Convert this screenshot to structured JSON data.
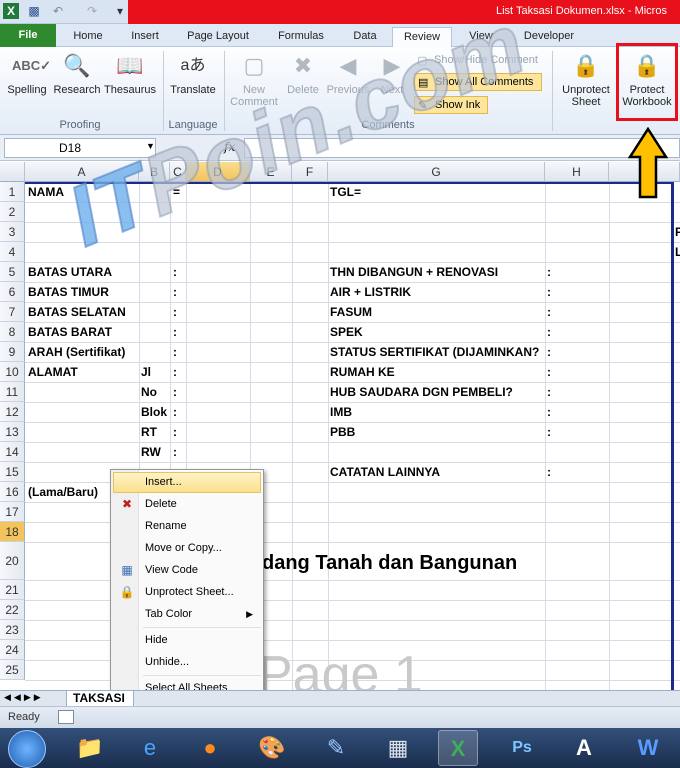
{
  "window": {
    "title": "List Taksasi Dokumen.xlsx - Micros",
    "qat_icons": [
      "excel-logo-icon",
      "save-icon",
      "undo-icon",
      "redo-icon",
      "customize-icon"
    ]
  },
  "tabs": [
    "File",
    "Home",
    "Insert",
    "Page Layout",
    "Formulas",
    "Data",
    "Review",
    "View",
    "Developer"
  ],
  "ribbon": {
    "proofing": {
      "label": "Proofing",
      "spelling": "Spelling",
      "research": "Research",
      "thesaurus": "Thesaurus"
    },
    "language": {
      "label": "Language",
      "translate": "Translate"
    },
    "comments": {
      "label": "Comments",
      "new_comment_1": "New",
      "new_comment_2": "Comment",
      "delete": "Delete",
      "previous": "Previous",
      "next": "Next",
      "show_hide": "Show/Hide Comment",
      "show_all": "Show All Comments",
      "show_ink": "Show Ink"
    },
    "changes": {
      "unprotect_1": "Unprotect",
      "unprotect_2": "Sheet",
      "protect_1": "Protect",
      "protect_2": "Workbook"
    }
  },
  "formula_bar": {
    "name_box": "D18",
    "fx": "fx",
    "formula": ""
  },
  "columns": [
    "A",
    "B",
    "C",
    "D",
    "E",
    "F",
    "G",
    "H"
  ],
  "rows": [
    "1",
    "2",
    "3",
    "4",
    "5",
    "6",
    "7",
    "8",
    "9",
    "10",
    "11",
    "12",
    "13",
    "14",
    "15",
    "16",
    "17",
    "18",
    "20",
    "21",
    "22",
    "23",
    "24",
    "25"
  ],
  "cells": {
    "r1_a": "NAMA",
    "r1_c": "=",
    "r1_g": "TGL=",
    "r3_i": "P",
    "r4_i": "L",
    "r5_a": "BATAS UTARA",
    "r5_c": ":",
    "r5_g": "THN DIBANGUN + RENOVASI",
    "r5_h": ":",
    "r6_a": "BATAS TIMUR",
    "r6_c": ":",
    "r6_g": "AIR + LISTRIK",
    "r6_h": ":",
    "r7_a": "BATAS SELATAN",
    "r7_c": ":",
    "r7_g": "FASUM",
    "r7_h": ":",
    "r8_a": "BATAS BARAT",
    "r8_c": ":",
    "r8_g": "SPEK",
    "r8_h": ":",
    "r9_a": "ARAH (Sertifikat)",
    "r9_c": ":",
    "r9_g": "STATUS SERTIFIKAT (DIJAMINKAN?",
    "r9_h": ":",
    "r10_a": "ALAMAT",
    "r10_b": "Jl",
    "r10_c": ":",
    "r10_g": "RUMAH KE",
    "r10_h": ":",
    "r11_b": "No",
    "r11_c": ":",
    "r11_g": "HUB SAUDARA DGN PEMBELI?",
    "r11_h": ":",
    "r12_b": "Blok",
    "r12_c": ":",
    "r12_g": "IMB",
    "r12_h": ":",
    "r13_b": "RT",
    "r13_c": ":",
    "r13_g": "PBB",
    "r13_h": ":",
    "r14_b": "RW",
    "r14_c": ":",
    "r15_g": "CATATAN LAINNYA",
    "r15_h": ":",
    "r16_a": "(Lama/Baru)",
    "r20_text": "dang Tanah dan Bangunan"
  },
  "watermark": {
    "prefix": "IT",
    "rest": "Poin.com"
  },
  "page_label": "Page 1",
  "context_menu": [
    {
      "label": "Insert...",
      "icon": "",
      "hover": true
    },
    {
      "label": "Delete",
      "icon": "delete-sheet-icon"
    },
    {
      "label": "Rename",
      "icon": ""
    },
    {
      "label": "Move or Copy...",
      "icon": ""
    },
    {
      "label": "View Code",
      "icon": "view-code-icon"
    },
    {
      "label": "Unprotect Sheet...",
      "icon": "lock-icon"
    },
    {
      "label": "Tab Color",
      "icon": "",
      "submenu": true
    },
    {
      "label": "Hide",
      "icon": ""
    },
    {
      "label": "Unhide...",
      "icon": ""
    },
    {
      "label": "Select All Sheets",
      "icon": ""
    }
  ],
  "sheet_tab": "TAKSASI",
  "status": {
    "ready": "Ready"
  },
  "taskbar": [
    "explorer-icon",
    "internet-explorer-icon",
    "firefox-icon",
    "paint-icon",
    "notepad-icon",
    "calculator-icon",
    "excel-icon",
    "photoshop-icon",
    "wordpad-icon",
    "word-icon"
  ],
  "colors": {
    "title_red": "#e8101b",
    "file_tab": "#2f8a2f",
    "highlight_box": "#e8101b",
    "arrow": "#ffc000"
  }
}
